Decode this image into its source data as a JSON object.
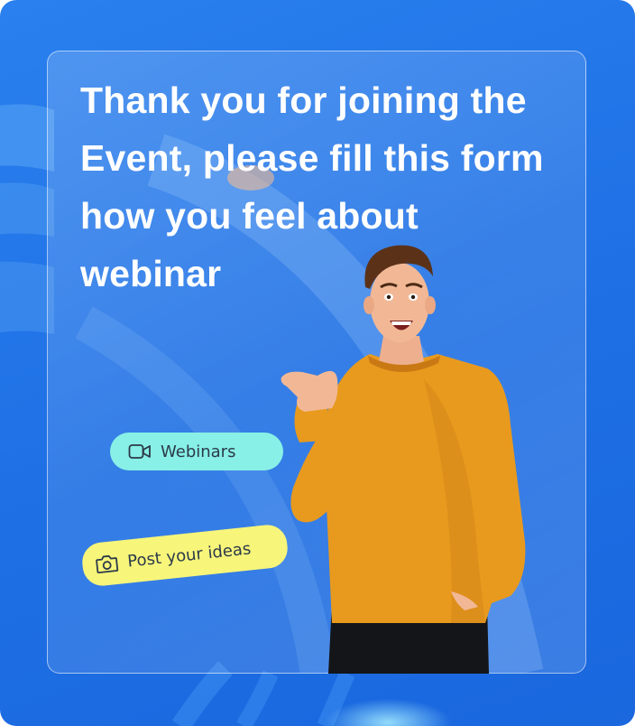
{
  "card": {
    "headline": "Thank you for joining the Event, please fill this form how you feel about webinar"
  },
  "chips": {
    "webinars": {
      "label": "Webinars",
      "icon": "video-camera-icon",
      "color": "#88f0e6"
    },
    "post_ideas": {
      "label": "Post your ideas",
      "icon": "camera-icon",
      "color": "#f7f57a"
    }
  },
  "colors": {
    "background": "#1e6fe4",
    "sweater": "#e89a1e",
    "text": "#ffffff"
  }
}
